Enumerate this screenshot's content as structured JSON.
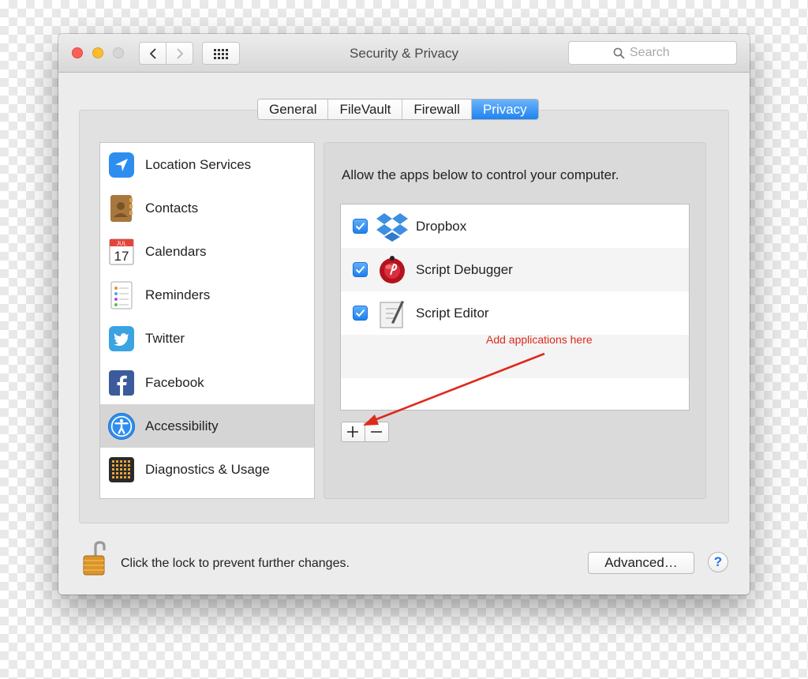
{
  "window": {
    "title": "Security & Privacy",
    "search_placeholder": "Search"
  },
  "tabs": [
    {
      "label": "General",
      "active": false
    },
    {
      "label": "FileVault",
      "active": false
    },
    {
      "label": "Firewall",
      "active": false
    },
    {
      "label": "Privacy",
      "active": true
    }
  ],
  "sidebar": {
    "items": [
      {
        "label": "Location Services",
        "icon": "location-arrow-icon"
      },
      {
        "label": "Contacts",
        "icon": "contacts-book-icon"
      },
      {
        "label": "Calendars",
        "icon": "calendar-icon",
        "icon_month": "JUL",
        "icon_day": "17"
      },
      {
        "label": "Reminders",
        "icon": "reminders-list-icon"
      },
      {
        "label": "Twitter",
        "icon": "twitter-bird-icon"
      },
      {
        "label": "Facebook",
        "icon": "facebook-icon"
      },
      {
        "label": "Accessibility",
        "icon": "accessibility-icon",
        "selected": true
      },
      {
        "label": "Diagnostics & Usage",
        "icon": "diagnostics-grid-icon"
      }
    ]
  },
  "main": {
    "instruction": "Allow the apps below to control your computer.",
    "apps": [
      {
        "name": "Dropbox",
        "checked": true,
        "icon": "dropbox-icon"
      },
      {
        "name": "Script Debugger",
        "checked": true,
        "icon": "script-debugger-icon"
      },
      {
        "name": "Script Editor",
        "checked": true,
        "icon": "script-editor-icon"
      }
    ],
    "add_label": "+",
    "remove_label": "−",
    "annotation": "Add applications here"
  },
  "footer": {
    "lock_text": "Click the lock to prevent further changes.",
    "advanced_label": "Advanced…",
    "help_label": "?"
  },
  "colors": {
    "accent_blue": "#1f83f0",
    "annotation_red": "#dd2b1c",
    "selected_row": "#d5d5d5"
  }
}
